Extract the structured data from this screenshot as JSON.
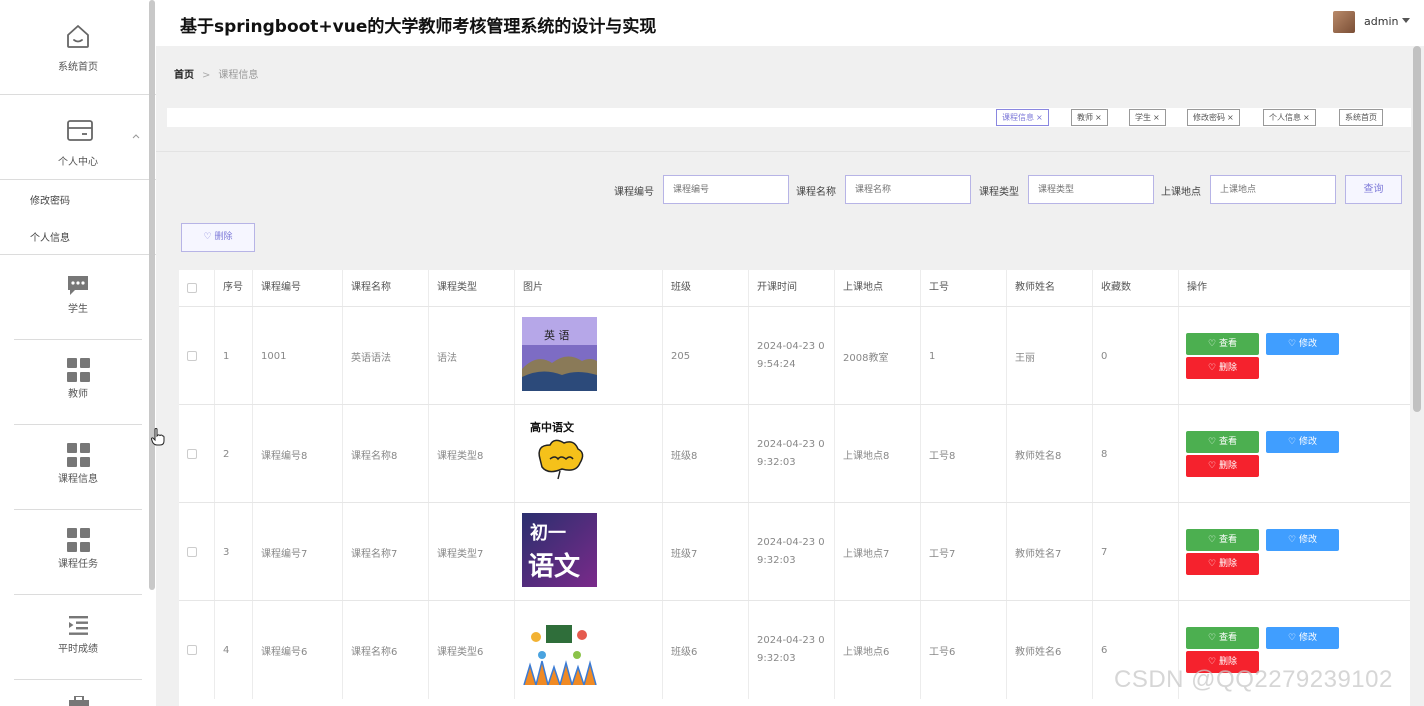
{
  "app": {
    "title": "基于springboot+vue的大学教师考核管理系统的设计与实现",
    "user": "admin"
  },
  "sidebar": {
    "home": "系统首页",
    "personal_center": "个人中心",
    "sub_items": [
      "修改密码",
      "个人信息"
    ],
    "items": [
      "学生",
      "教师",
      "课程信息",
      "课程任务",
      "平时成绩"
    ]
  },
  "breadcrumb": {
    "home": "首页",
    "sep": ">",
    "current": "课程信息"
  },
  "tags": [
    {
      "label": "课程信息",
      "x": "×",
      "active": true
    },
    {
      "label": "教师",
      "x": "×",
      "active": false
    },
    {
      "label": "学生",
      "x": "×",
      "active": false
    },
    {
      "label": "修改密码",
      "x": "×",
      "active": false
    },
    {
      "label": "个人信息",
      "x": "×",
      "active": false
    },
    {
      "label": "系统首页",
      "x": "",
      "active": false
    }
  ],
  "search": {
    "fields": [
      {
        "label": "课程编号",
        "placeholder": "课程编号"
      },
      {
        "label": "课程名称",
        "placeholder": "课程名称"
      },
      {
        "label": "课程类型",
        "placeholder": "课程类型"
      },
      {
        "label": "上课地点",
        "placeholder": "上课地点"
      }
    ],
    "button": "查询"
  },
  "actions": {
    "delete_batch": "删除",
    "view": "查看",
    "edit": "修改",
    "delete": "删除"
  },
  "table": {
    "headers": [
      "序号",
      "课程编号",
      "课程名称",
      "课程类型",
      "图片",
      "班级",
      "开课时间",
      "上课地点",
      "工号",
      "教师姓名",
      "收藏数",
      "操作"
    ],
    "rows": [
      {
        "no": "1",
        "code": "1001",
        "name": "英语语法",
        "type": "语法",
        "image": "book-cover-english",
        "class": "205",
        "time1": "2024-04-23 0",
        "time2": "9:54:24",
        "place": "2008教室",
        "job_no": "1",
        "teacher": "王丽",
        "fav": "0"
      },
      {
        "no": "2",
        "code": "课程编号8",
        "name": "课程名称8",
        "type": "课程类型8",
        "image": "cover-chinese-senior",
        "image_text": "高中语文",
        "class": "班级8",
        "time1": "2024-04-23 0",
        "time2": "9:32:03",
        "place": "上课地点8",
        "job_no": "工号8",
        "teacher": "教师姓名8",
        "fav": "8"
      },
      {
        "no": "3",
        "code": "课程编号7",
        "name": "课程名称7",
        "type": "课程类型7",
        "image": "cover-chinese-junior",
        "image_text_1": "初一",
        "image_text_2": "语文",
        "class": "班级7",
        "time1": "2024-04-23 0",
        "time2": "9:32:03",
        "place": "上课地点7",
        "job_no": "工号7",
        "teacher": "教师姓名7",
        "fav": "7"
      },
      {
        "no": "4",
        "code": "课程编号6",
        "name": "课程名称6",
        "type": "课程类型6",
        "image": "cover-class-illustration",
        "class": "班级6",
        "time1": "2024-04-23 0",
        "time2": "9:32:03",
        "place": "上课地点6",
        "job_no": "工号6",
        "teacher": "教师姓名6",
        "fav": "6"
      }
    ]
  },
  "watermark": "CSDN @QQ2279239102",
  "colors": {
    "accent": "#7f7bd9",
    "view": "#4caf50",
    "edit": "#409eff",
    "delete": "#f5222d"
  }
}
